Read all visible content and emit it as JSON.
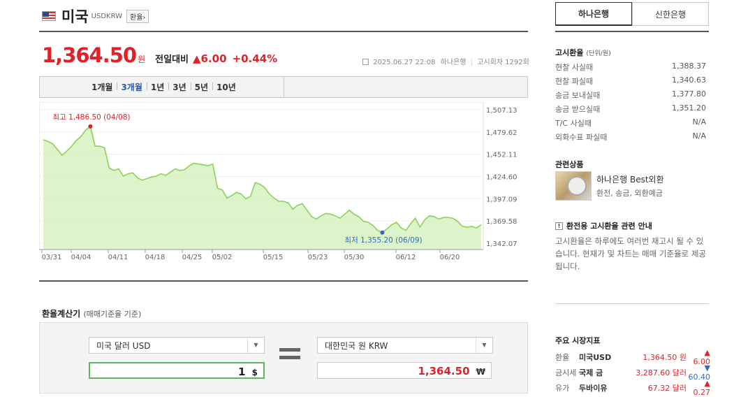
{
  "header": {
    "country": "미국",
    "code": "USDKRW",
    "tag_button": "환율›"
  },
  "price": {
    "value": "1,364.50",
    "unit": "원",
    "diff_label": "전일대비",
    "diff": "▲6.00",
    "pct": "+0.44%"
  },
  "meta": {
    "date": "2025.06.27 22:08",
    "bank": "하나은행",
    "notice": "고시회차 1292회"
  },
  "periods": [
    {
      "label": "1개월",
      "active": false
    },
    {
      "label": "3개월",
      "active": true
    },
    {
      "label": "1년",
      "active": false
    },
    {
      "label": "3년",
      "active": false
    },
    {
      "label": "5년",
      "active": false
    },
    {
      "label": "10년",
      "active": false
    }
  ],
  "chart_data": {
    "type": "area",
    "x_ticks": [
      "03/31",
      "04/04",
      "04/11",
      "04/18",
      "04/25",
      "05/02",
      "05/15",
      "05/23",
      "05/30",
      "06/12",
      "06/20"
    ],
    "y_ticks": [
      "1,507.13",
      "1,479.62",
      "1,452.11",
      "1,424.60",
      "1,397.09",
      "1,369.58",
      "1,342.07"
    ],
    "ylim": [
      1342.07,
      1507.13
    ],
    "values": [
      1470,
      1468,
      1465,
      1458,
      1451,
      1456,
      1462,
      1469,
      1474,
      1482,
      1486.5,
      1462,
      1462,
      1460,
      1435,
      1432,
      1434,
      1425,
      1428,
      1429,
      1423,
      1420,
      1422,
      1424,
      1425,
      1428,
      1426,
      1430,
      1434,
      1432,
      1433,
      1438,
      1441,
      1440,
      1439,
      1438,
      1440,
      1410,
      1408,
      1398,
      1401,
      1405,
      1403,
      1397,
      1400,
      1417,
      1415,
      1411,
      1403,
      1398,
      1394,
      1394,
      1392,
      1384,
      1389,
      1391,
      1383,
      1375,
      1372,
      1376,
      1379,
      1378,
      1376,
      1373,
      1378,
      1383,
      1378,
      1375,
      1369,
      1368,
      1364,
      1358,
      1355.2,
      1360,
      1365,
      1368,
      1361,
      1358,
      1366,
      1373,
      1362,
      1371,
      1376,
      1375,
      1372,
      1374,
      1374,
      1373,
      1369,
      1363,
      1362,
      1363,
      1361,
      1365
    ],
    "max_label": "최고 1,486.50 (04/08)",
    "min_label": "최저 1,355.20 (06/09)",
    "line_color": "#8ad25a",
    "fill_color": "#d5f0bd",
    "max_color": "#e0212a",
    "min_color": "#2d6bc4"
  },
  "calculator": {
    "title": "환율계산기",
    "subtitle": "(매매기준율 기준)",
    "from_currency": "미국 달러 USD",
    "from_value": "1",
    "from_unit": "$",
    "to_currency": "대한민국 원 KRW",
    "to_value": "1,364.50",
    "to_unit": "₩"
  },
  "banks": [
    {
      "label": "하나은행",
      "active": true
    },
    {
      "label": "신한은행",
      "active": false
    }
  ],
  "notice_rates": {
    "title": "고시환율",
    "unit": "(단위/원)",
    "rows": [
      {
        "label": "현찰 사실때",
        "value": "1,388.37"
      },
      {
        "label": "현찰 파실때",
        "value": "1,340.63"
      },
      {
        "label": "송금 보내실때",
        "value": "1,377.80"
      },
      {
        "label": "송금 받으실때",
        "value": "1,351.20"
      },
      {
        "label": "T/C 사실때",
        "value": "N/A"
      },
      {
        "label": "외화수표 파실때",
        "value": "N/A"
      }
    ]
  },
  "related": {
    "title": "관련상품",
    "product_name": "하나은행 Best외환",
    "product_desc": "환전, 송금, 외환예금"
  },
  "note": {
    "title": "환전용 고시환율 관련 안내",
    "text": "고시환율은 하루에도 여러번 재고시 될 수 있습니다. 현재가 및 차트는 매매 기준율로 제공됩니다."
  },
  "market": {
    "title": "주요 시장지표",
    "rows": [
      {
        "cat": "환율",
        "name": "미국USD",
        "value": "1,364.50 원",
        "change": "▲ 6.00",
        "up": true
      },
      {
        "cat": "금시세",
        "name": "국제 금",
        "value": "3,287.60 달러",
        "change": "▼ 60.40",
        "up": false
      },
      {
        "cat": "유가",
        "name": "두바이유",
        "value": "67.32 달러",
        "change": "▲ 0.27",
        "up": true
      }
    ]
  }
}
